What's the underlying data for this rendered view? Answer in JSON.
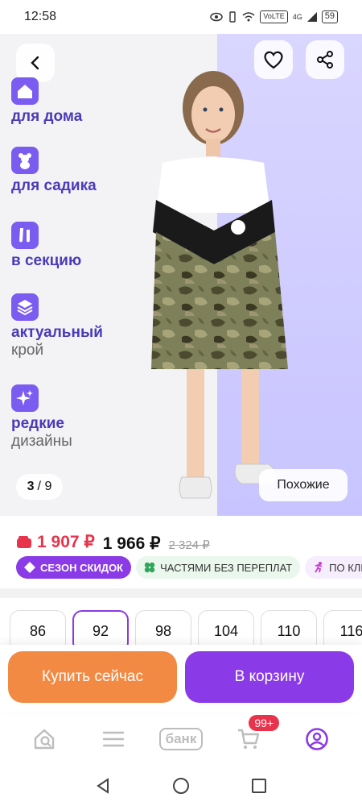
{
  "status": {
    "time": "12:58",
    "net": "VoLTE",
    "signal": "4G",
    "battery": "59"
  },
  "hero": {
    "features": [
      {
        "bold": "для дома",
        "light": "",
        "icon": "house-icon"
      },
      {
        "bold": "для садика",
        "light": "",
        "icon": "teddy-bear-icon"
      },
      {
        "bold": "в секцию",
        "light": "",
        "icon": "ballet-shoes-icon"
      },
      {
        "bold": "актуальный",
        "light": "крой",
        "icon": "layers-icon"
      },
      {
        "bold": "редкие",
        "light": "дизайны",
        "icon": "sparkles-icon"
      }
    ],
    "counter_current": "3",
    "counter_total": "/ 9",
    "similar_label": "Похожие"
  },
  "price": {
    "sale": "1 907 ₽",
    "main": "1 966 ₽",
    "old": "2 324 ₽"
  },
  "badges": {
    "sale": "СЕЗОН СКИДОК",
    "parts": "ЧАСТЯМИ БЕЗ ПЕРЕПЛАТ",
    "click": "ПО КЛИ"
  },
  "sizes": [
    "86",
    "92",
    "98",
    "104",
    "110",
    "116"
  ],
  "selected_size": "92",
  "actions": {
    "buy": "Купить сейчас",
    "cart": "В корзину"
  },
  "tabbar": {
    "bank": "банк",
    "cart_count": "99+"
  },
  "colors": {
    "accent": "#8a3ae6",
    "orange": "#f28a44",
    "red": "#e7334b"
  }
}
